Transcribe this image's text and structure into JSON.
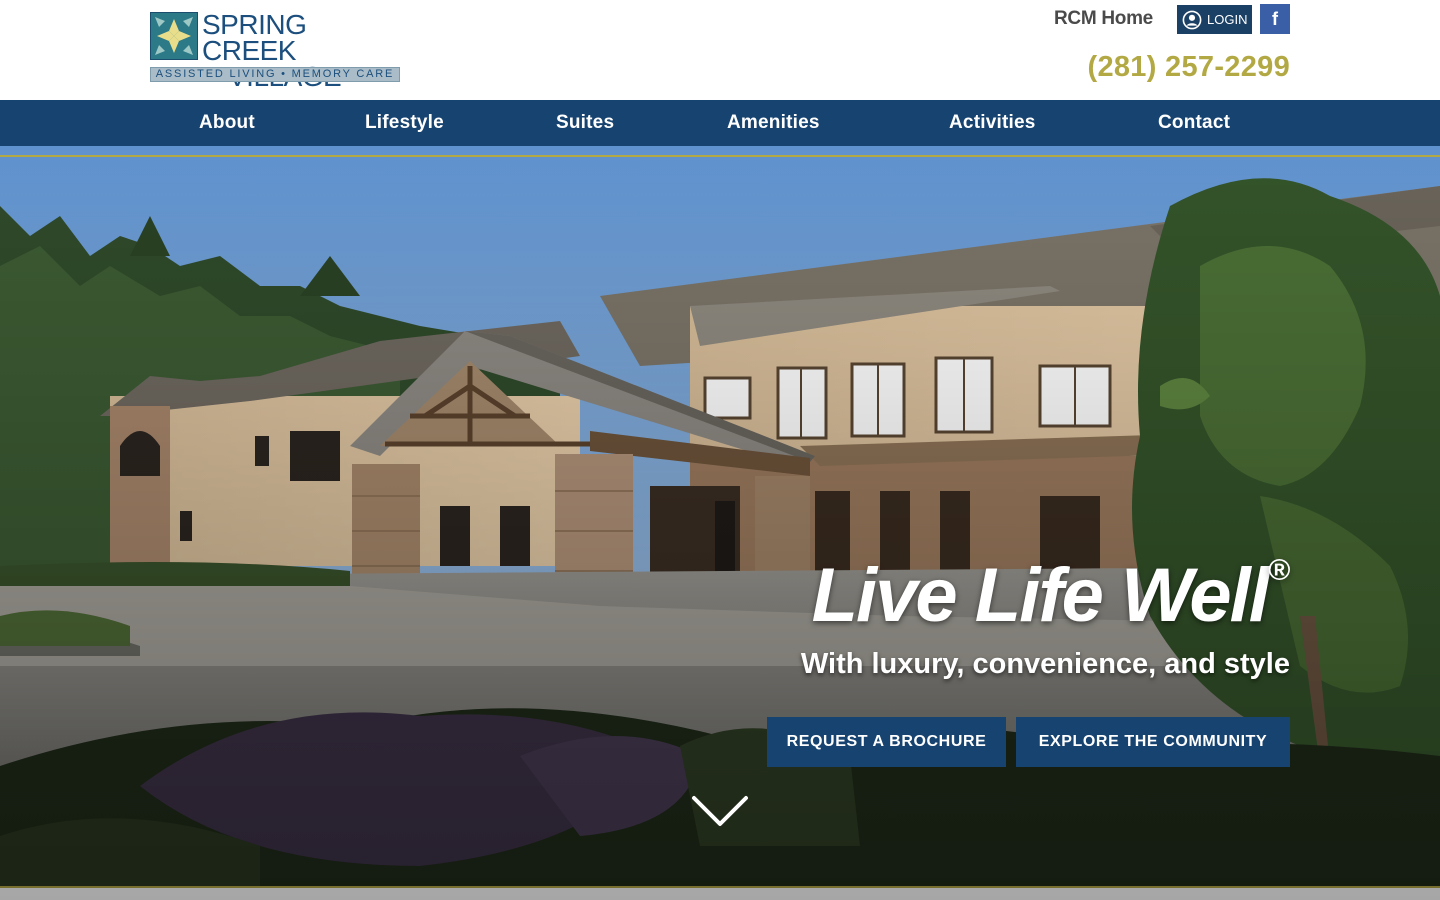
{
  "header": {
    "logo": {
      "title_line1": "SPRING CREEK",
      "title_line2": "VILLAGE",
      "tagline": "ASSISTED LIVING • MEMORY CARE"
    },
    "rcm_home": "RCM Home",
    "login_label": "LOGIN",
    "facebook_label": "f",
    "phone": "(281) 257-2299"
  },
  "nav": {
    "items": [
      {
        "label": "About"
      },
      {
        "label": "Lifestyle"
      },
      {
        "label": "Suites"
      },
      {
        "label": "Amenities"
      },
      {
        "label": "Activities"
      },
      {
        "label": "Contact"
      }
    ]
  },
  "hero": {
    "headline": "Live Life Well",
    "headline_mark": "®",
    "subheadline": "With luxury, convenience, and style",
    "buttons": {
      "brochure": "REQUEST A BROCHURE",
      "explore": "EXPLORE THE COMMUNITY"
    }
  },
  "icons": {
    "login": "user-circle-icon",
    "facebook": "facebook-icon",
    "scroll": "chevron-down-icon"
  },
  "colors": {
    "navy": "#174370",
    "gold": "#b3a944",
    "facebook": "#3b5fa7",
    "logo_blue": "#1c4f7d"
  }
}
